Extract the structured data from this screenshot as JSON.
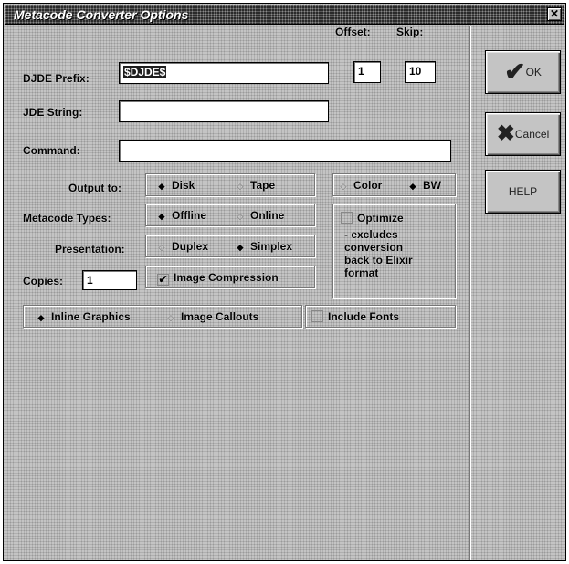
{
  "window": {
    "title": "Metacode Converter Options",
    "close_glyph": "✕"
  },
  "fields": {
    "djde_prefix": {
      "label": "DJDE Prefix:",
      "value": "$DJDE$"
    },
    "offset": {
      "label": "Offset:",
      "value": "1"
    },
    "skip": {
      "label": "Skip:",
      "value": "10"
    },
    "jde_string": {
      "label": "JDE String:",
      "value": ""
    },
    "command": {
      "label": "Command:",
      "value": ""
    },
    "copies": {
      "label": "Copies:",
      "value": "1"
    }
  },
  "output_to": {
    "label": "Output to:",
    "options": [
      "Disk",
      "Tape"
    ],
    "selected": "Disk"
  },
  "color_mode": {
    "options": [
      "Color",
      "BW"
    ],
    "selected": "BW"
  },
  "metacode_types": {
    "label": "Metacode Types:",
    "options": [
      "Offline",
      "Online"
    ],
    "selected": "Offline"
  },
  "presentation": {
    "label": "Presentation:",
    "options": [
      "Duplex",
      "Simplex"
    ],
    "selected": "Simplex"
  },
  "optimize": {
    "label": "Optimize",
    "checked": false,
    "note_lines": [
      "- excludes",
      "conversion",
      "back to Elixir",
      "format"
    ]
  },
  "image_compression": {
    "label": "Image Compression",
    "checked": true,
    "check_glyph": "✔"
  },
  "graphics": {
    "options": [
      "Inline Graphics",
      "Image Callouts"
    ],
    "selected": "Inline Graphics"
  },
  "include_fonts": {
    "label": "Include Fonts",
    "checked": false
  },
  "buttons": {
    "ok": {
      "label": "OK",
      "icon": "checkmark-icon",
      "glyph": "✔"
    },
    "cancel": {
      "label": "Cancel",
      "icon": "x-icon",
      "glyph": "✖"
    },
    "help": {
      "label": "HELP"
    }
  }
}
